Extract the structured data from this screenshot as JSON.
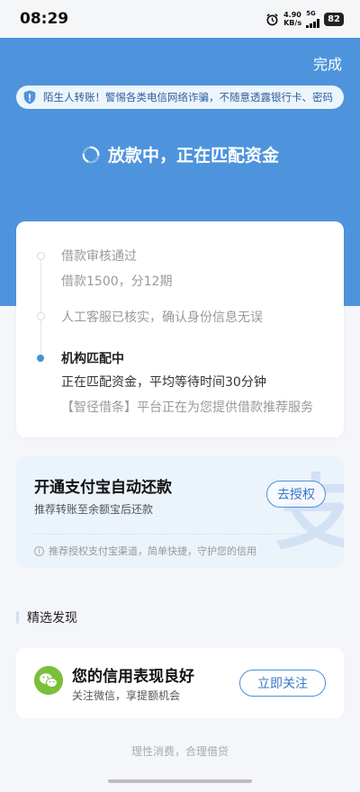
{
  "status_bar": {
    "time": "08:29",
    "speed_value": "4.90",
    "speed_unit": "KB/s",
    "network": "5G",
    "battery": "82"
  },
  "header": {
    "done_label": "完成",
    "notice_text": "陌生人转账！警惕各类电信网络诈骗，不随意透露银行卡、密码",
    "status_text": "放款中，正在匹配资金",
    "bg_color": "#4e94dc"
  },
  "progress": {
    "steps": [
      {
        "title": "借款审核通过",
        "sub": "借款1500，分12期"
      },
      {
        "title": "人工客服已核实，确认身份信息无误"
      },
      {
        "title": "机构匹配中",
        "sub": "正在匹配资金，平均等待时间30分钟",
        "sub2": "【智径借条】平台正在为您提供借款推荐服务"
      }
    ]
  },
  "alipay": {
    "title": "开通支付宝自动还款",
    "desc": "推荐转账至余额宝后还款",
    "button": "去授权",
    "tip": "推荐授权支付宝渠道，简单快捷，守护您的信用",
    "watermark": "支"
  },
  "discover": {
    "section_title": "精选发现",
    "card_title": "您的信用表现良好",
    "card_desc": "关注微信，享提额机会",
    "button": "立即关注"
  },
  "footer": {
    "text": "理性消费，合理借贷"
  },
  "colors": {
    "accent": "#4a90d9",
    "wechat_green": "#7bbf3a"
  }
}
